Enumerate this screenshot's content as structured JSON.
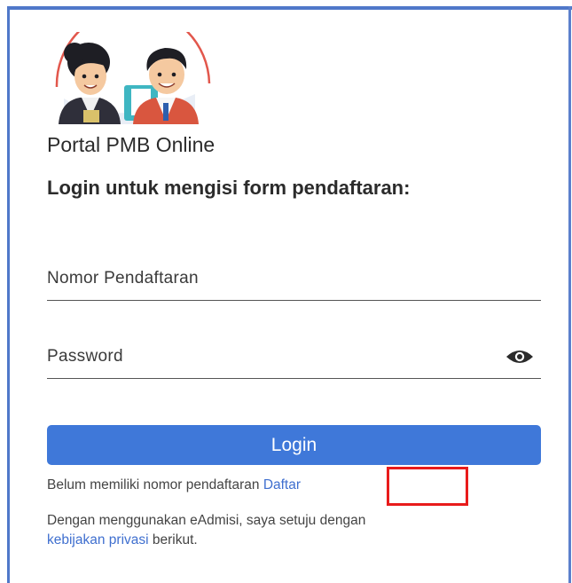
{
  "logo": {
    "icon": "mascot-couple-logo",
    "ring_color": "#e2574c"
  },
  "page": {
    "title": "Portal PMB Online",
    "subtitle": "Login untuk mengisi form pendaftaran:"
  },
  "form": {
    "registration_number": {
      "placeholder": "Nomor Pendaftaran",
      "value": ""
    },
    "password": {
      "placeholder": "Password",
      "value": "",
      "toggle_icon": "eye-icon"
    },
    "login_label": "Login"
  },
  "register": {
    "prompt": "Belum memiliki nomor pendaftaran",
    "link_label": "Daftar",
    "highlight_color": "#e81b1b"
  },
  "consent": {
    "text": "Dengan menggunakan eAdmisi, saya setuju dengan",
    "link_label": "kebijakan privasi",
    "suffix": "berikut."
  },
  "colors": {
    "accent": "#3f78d9",
    "link": "#3f6fcf",
    "frame": "#4f78c9"
  }
}
